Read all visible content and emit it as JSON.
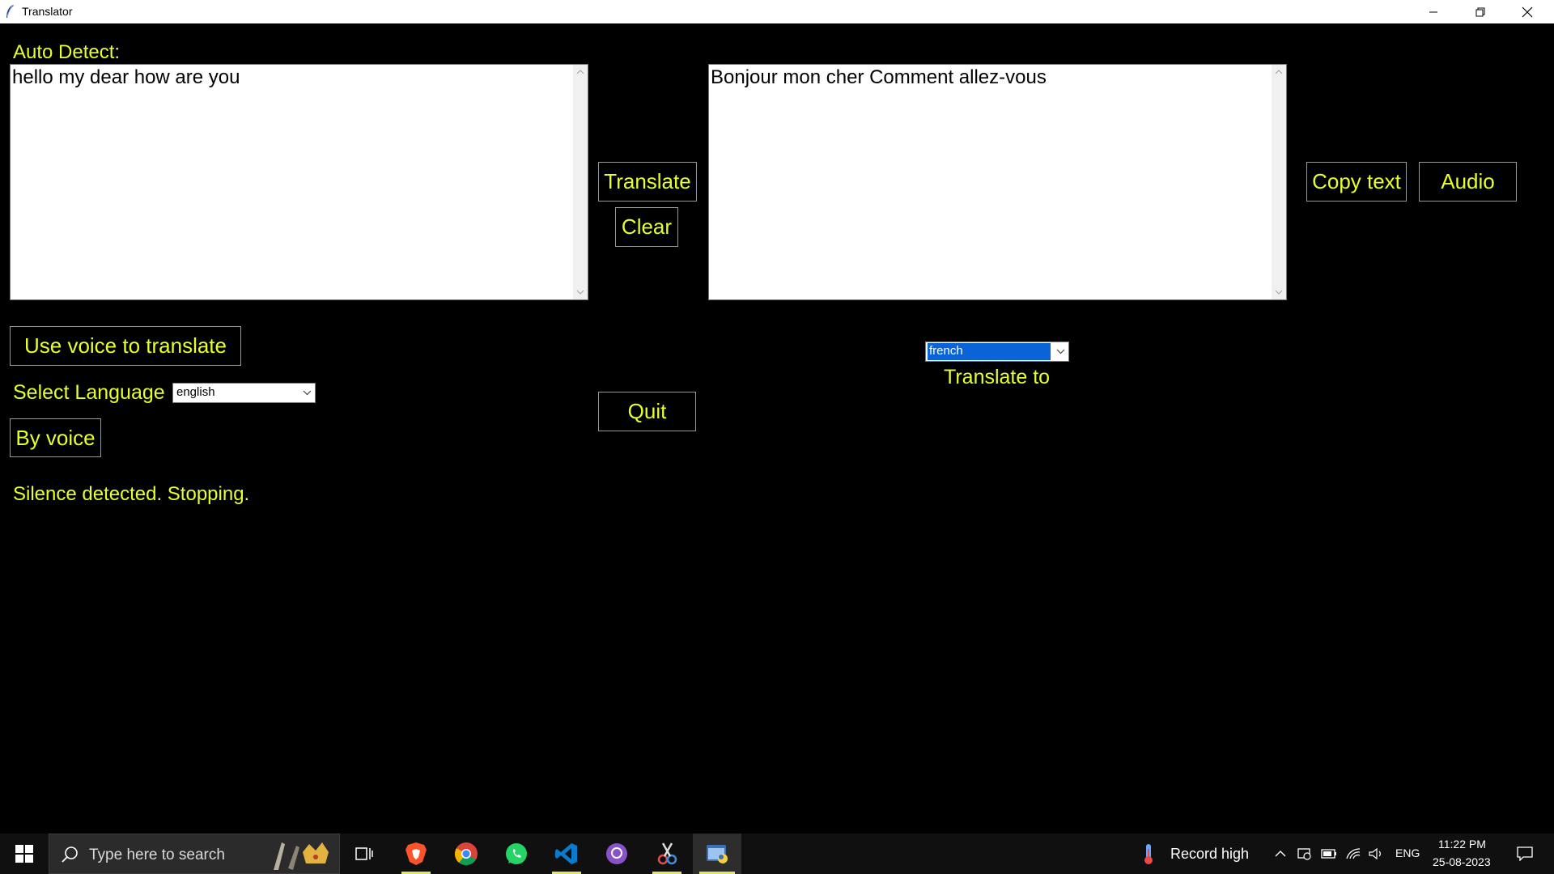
{
  "window": {
    "title": "Translator"
  },
  "source": {
    "label": "Auto Detect:",
    "text": "hello my dear how are you",
    "select_language_label": "Select Language",
    "language": "english"
  },
  "target": {
    "text": "Bonjour mon cher Comment allez-vous",
    "language": "french",
    "translate_to_label": "Translate to"
  },
  "buttons": {
    "translate": "Translate",
    "clear": "Clear",
    "copy_text": "Copy text",
    "audio": "Audio",
    "use_voice": "Use voice to translate",
    "by_voice": "By voice",
    "quit": "Quit"
  },
  "status": "Silence detected. Stopping.",
  "taskbar": {
    "search_placeholder": "Type here to search",
    "weather": "Record high",
    "lang": "ENG",
    "time": "11:22 PM",
    "date": "25-08-2023"
  },
  "colors": {
    "accent_text": "#e8ff2a",
    "background": "#000000",
    "taskbar": "#101010"
  }
}
